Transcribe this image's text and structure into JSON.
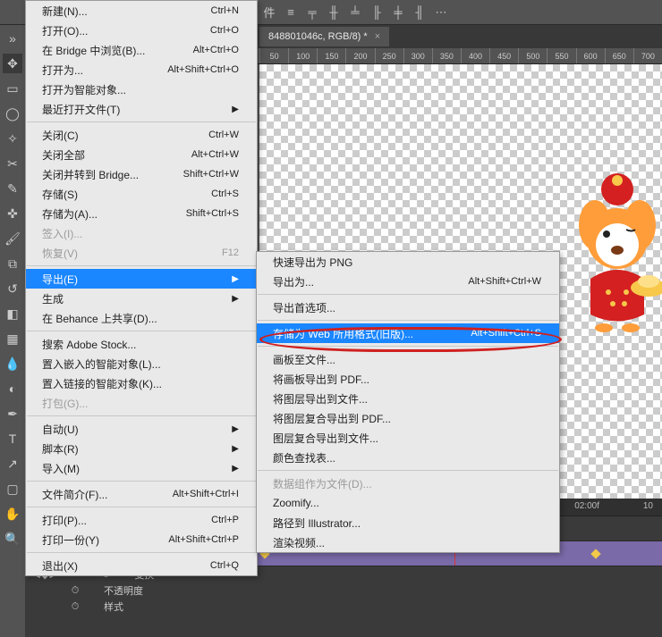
{
  "appbar": {
    "opt_label": "件"
  },
  "doc": {
    "title": "848801046c, RGB/8) *"
  },
  "ruler": {
    "ticks": [
      "50",
      "100",
      "150",
      "200",
      "250",
      "300",
      "350",
      "400",
      "450",
      "500",
      "550",
      "600",
      "650",
      "700"
    ]
  },
  "menu1": {
    "new": "新建(N)...",
    "new_sc": "Ctrl+N",
    "open": "打开(O)...",
    "open_sc": "Ctrl+O",
    "browse": "在 Bridge 中浏览(B)...",
    "browse_sc": "Alt+Ctrl+O",
    "openas": "打开为...",
    "openas_sc": "Alt+Shift+Ctrl+O",
    "openassmart": "打开为智能对象...",
    "recent": "最近打开文件(T)",
    "close": "关闭(C)",
    "close_sc": "Ctrl+W",
    "closeall": "关闭全部",
    "closeall_sc": "Alt+Ctrl+W",
    "closegoto": "关闭并转到 Bridge...",
    "closegoto_sc": "Shift+Ctrl+W",
    "save": "存储(S)",
    "save_sc": "Ctrl+S",
    "saveas": "存储为(A)...",
    "saveas_sc": "Shift+Ctrl+S",
    "checkin": "签入(I)...",
    "revert": "恢复(V)",
    "revert_sc": "F12",
    "export": "导出(E)",
    "generate": "生成",
    "behance": "在 Behance 上共享(D)...",
    "searchstock": "搜索 Adobe Stock...",
    "placeembed": "置入嵌入的智能对象(L)...",
    "placelink": "置入链接的智能对象(K)...",
    "package": "打包(G)...",
    "auto": "自动(U)",
    "scripts": "脚本(R)",
    "import": "导入(M)",
    "fileinfo": "文件简介(F)...",
    "fileinfo_sc": "Alt+Shift+Ctrl+I",
    "print": "打印(P)...",
    "print_sc": "Ctrl+P",
    "printone": "打印一份(Y)",
    "printone_sc": "Alt+Shift+Ctrl+P",
    "exit": "退出(X)",
    "exit_sc": "Ctrl+Q"
  },
  "menu2": {
    "quickpng": "快速导出为 PNG",
    "exportas": "导出为...",
    "exportas_sc": "Alt+Shift+Ctrl+W",
    "exportprefs": "导出首选项...",
    "saveforweb": "存储为 Web 所用格式(旧版)...",
    "saveforweb_sc": "Alt+Shift+Ctrl+S",
    "artboardfile": "画板至文件...",
    "artboardpdf": "将画板导出到 PDF...",
    "layersfile": "将图层导出到文件...",
    "layerspdf": "将图层复合导出到 PDF...",
    "layerscompfile": "图层复合导出到文件...",
    "colorlut": "颜色查找表...",
    "datasets": "数据组作为文件(D)...",
    "zoomify": "Zoomify...",
    "toillustrator": "路径到 Illustrator...",
    "rendervideo": "渲染视频..."
  },
  "timeline": {
    "marks": {
      "a": "02:00f",
      "b": "10"
    },
    "transform": "变换",
    "opacity": "不透明度",
    "style": "样式"
  }
}
